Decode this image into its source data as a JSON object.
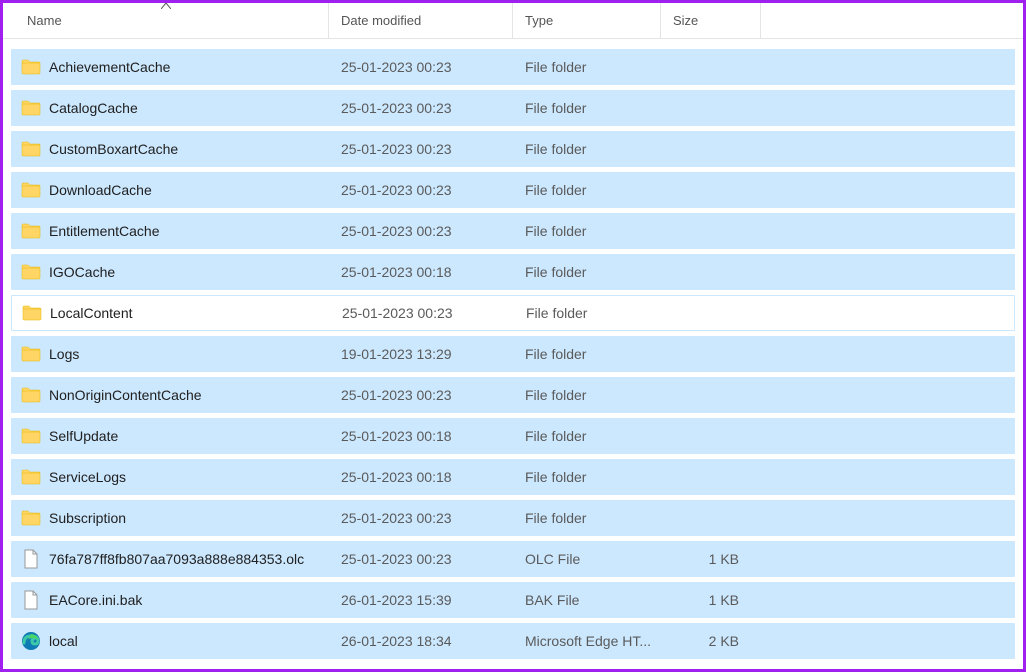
{
  "columns": {
    "name": "Name",
    "date_modified": "Date modified",
    "type": "Type",
    "size": "Size"
  },
  "items": [
    {
      "icon": "folder",
      "name": "AchievementCache",
      "date": "25-01-2023 00:23",
      "type": "File folder",
      "size": "",
      "selected": true
    },
    {
      "icon": "folder",
      "name": "CatalogCache",
      "date": "25-01-2023 00:23",
      "type": "File folder",
      "size": "",
      "selected": true
    },
    {
      "icon": "folder",
      "name": "CustomBoxartCache",
      "date": "25-01-2023 00:23",
      "type": "File folder",
      "size": "",
      "selected": true
    },
    {
      "icon": "folder",
      "name": "DownloadCache",
      "date": "25-01-2023 00:23",
      "type": "File folder",
      "size": "",
      "selected": true
    },
    {
      "icon": "folder",
      "name": "EntitlementCache",
      "date": "25-01-2023 00:23",
      "type": "File folder",
      "size": "",
      "selected": true
    },
    {
      "icon": "folder",
      "name": "IGOCache",
      "date": "25-01-2023 00:18",
      "type": "File folder",
      "size": "",
      "selected": true
    },
    {
      "icon": "folder",
      "name": "LocalContent",
      "date": "25-01-2023 00:23",
      "type": "File folder",
      "size": "",
      "selected": false
    },
    {
      "icon": "folder",
      "name": "Logs",
      "date": "19-01-2023 13:29",
      "type": "File folder",
      "size": "",
      "selected": true
    },
    {
      "icon": "folder",
      "name": "NonOriginContentCache",
      "date": "25-01-2023 00:23",
      "type": "File folder",
      "size": "",
      "selected": true
    },
    {
      "icon": "folder",
      "name": "SelfUpdate",
      "date": "25-01-2023 00:18",
      "type": "File folder",
      "size": "",
      "selected": true
    },
    {
      "icon": "folder",
      "name": "ServiceLogs",
      "date": "25-01-2023 00:18",
      "type": "File folder",
      "size": "",
      "selected": true
    },
    {
      "icon": "folder",
      "name": "Subscription",
      "date": "25-01-2023 00:23",
      "type": "File folder",
      "size": "",
      "selected": true
    },
    {
      "icon": "file",
      "name": "76fa787ff8fb807aa7093a888e884353.olc",
      "date": "25-01-2023 00:23",
      "type": "OLC File",
      "size": "1 KB",
      "selected": true
    },
    {
      "icon": "file",
      "name": "EACore.ini.bak",
      "date": "26-01-2023 15:39",
      "type": "BAK File",
      "size": "1 KB",
      "selected": true
    },
    {
      "icon": "edge",
      "name": "local",
      "date": "26-01-2023 18:34",
      "type": "Microsoft Edge HT...",
      "size": "2 KB",
      "selected": true
    }
  ]
}
